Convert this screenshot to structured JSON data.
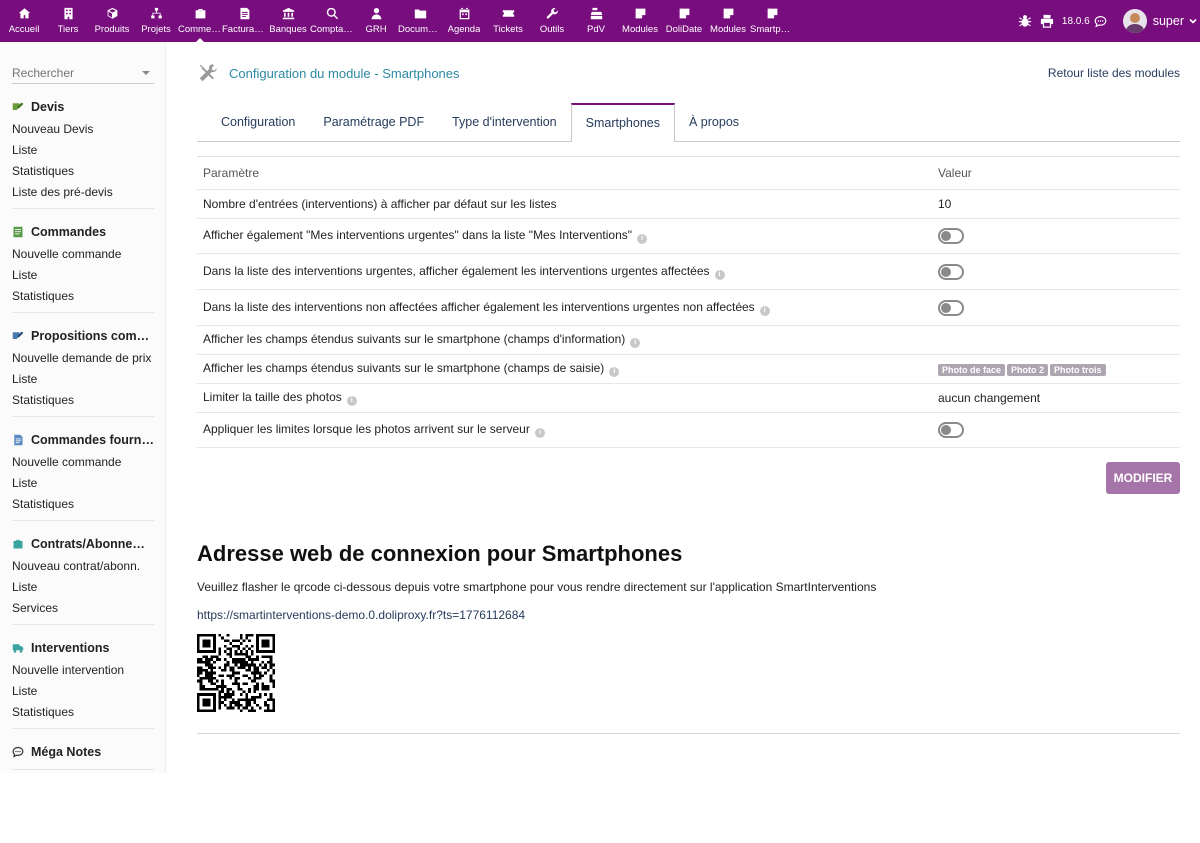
{
  "topnav": [
    {
      "label": "Accueil",
      "icon": "home-icon"
    },
    {
      "label": "Tiers",
      "icon": "building-icon"
    },
    {
      "label": "Produits",
      "icon": "cube-icon"
    },
    {
      "label": "Projets",
      "icon": "sitemap-icon"
    },
    {
      "label": "Commercial",
      "icon": "briefcase-icon",
      "active": true
    },
    {
      "label": "Facturation",
      "icon": "invoice-icon"
    },
    {
      "label": "Banques",
      "icon": "bank-icon"
    },
    {
      "label": "Comptabilité",
      "icon": "magnifier-icon"
    },
    {
      "label": "GRH",
      "icon": "user-tie-icon"
    },
    {
      "label": "Documents",
      "icon": "folder-icon"
    },
    {
      "label": "Agenda",
      "icon": "calendar-icon"
    },
    {
      "label": "Tickets",
      "icon": "ticket-icon"
    },
    {
      "label": "Outils",
      "icon": "wrench-icon"
    },
    {
      "label": "PdV",
      "icon": "cash-register-icon"
    },
    {
      "label": "Modules",
      "icon": "note-icon"
    },
    {
      "label": "DoliDate",
      "icon": "note-icon"
    },
    {
      "label": "Modules",
      "icon": "note-icon"
    },
    {
      "label": "Smartphones",
      "icon": "note-icon"
    }
  ],
  "topright": {
    "version": "18.0.6",
    "username": "super"
  },
  "sidebar": {
    "search_placeholder": "Rechercher",
    "blocks": [
      {
        "title": "Devis",
        "icon": "proposal-icon",
        "color": "#6a9a3a",
        "links": [
          "Nouveau Devis",
          "Liste",
          "Statistiques",
          "Liste des pré-devis"
        ]
      },
      {
        "title": "Commandes",
        "icon": "order-icon",
        "color": "#5a9a4a",
        "links": [
          "Nouvelle commande",
          "Liste",
          "Statistiques"
        ]
      },
      {
        "title": "Propositions commerciales fournisseurs",
        "icon": "supplier-proposal-icon",
        "color": "#4a7ab0",
        "links": [
          "Nouvelle demande de prix",
          "Liste",
          "Statistiques"
        ]
      },
      {
        "title": "Commandes fournisseurs",
        "icon": "supplier-order-icon",
        "color": "#5a8ac0",
        "links": [
          "Nouvelle commande",
          "Liste",
          "Statistiques"
        ]
      },
      {
        "title": "Contrats/Abonnements",
        "icon": "contract-icon",
        "color": "#3aa3a0",
        "links": [
          "Nouveau contrat/abonn.",
          "Liste",
          "Services"
        ]
      },
      {
        "title": "Interventions",
        "icon": "truck-icon",
        "color": "#3aa3a0",
        "links": [
          "Nouvelle intervention",
          "Liste",
          "Statistiques"
        ]
      },
      {
        "title": "Méga Notes",
        "icon": "comment-icon",
        "color": "#333333",
        "links": []
      }
    ]
  },
  "header": {
    "title": "Configuration du module - Smartphones",
    "back_link": "Retour liste des modules"
  },
  "tabs": [
    "Configuration",
    "Paramétrage PDF",
    "Type d'intervention",
    "Smartphones",
    "À propos"
  ],
  "active_tab": 3,
  "table": {
    "headers": [
      "Paramètre",
      "Valeur"
    ],
    "rows": [
      {
        "label": "Nombre d'entrées (interventions) à afficher par défaut sur les listes",
        "info": false,
        "type": "text",
        "value": "10"
      },
      {
        "label": "Afficher également \"Mes interventions urgentes\" dans la liste \"Mes Interventions\"",
        "info": true,
        "type": "toggle",
        "value": "off"
      },
      {
        "label": "Dans la liste des interventions urgentes, afficher également les interventions urgentes affectées",
        "info": true,
        "type": "toggle",
        "value": "off"
      },
      {
        "label": "Dans la liste des interventions non affectées afficher également les interventions urgentes non affectées",
        "info": true,
        "type": "toggle",
        "value": "off"
      },
      {
        "label": "Afficher les champs étendus suivants sur le smartphone (champs d'information)",
        "info": true,
        "type": "text",
        "value": ""
      },
      {
        "label": "Afficher les champs étendus suivants sur le smartphone (champs de saisie)",
        "info": true,
        "type": "tags",
        "value": [
          "Photo de face",
          "Photo 2",
          "Photo trois"
        ]
      },
      {
        "label": "Limiter la taille des photos",
        "info": true,
        "type": "text",
        "value": "aucun changement"
      },
      {
        "label": "Appliquer les limites lorsque les photos arrivent sur le serveur",
        "info": true,
        "type": "toggle",
        "value": "off"
      }
    ]
  },
  "modify_button": "MODIFIER",
  "section": {
    "title": "Adresse web de connexion pour Smartphones",
    "description": "Veuillez flasher le qrcode ci-dessous depuis votre smartphone pour vous rendre directement sur l'application SmartInterventions",
    "url": "https://smartinterventions-demo.0.doliproxy.fr?ts=1776112684"
  },
  "colors": {
    "topbar": "#780d7e",
    "button": "#a574a8",
    "title": "#2b8aa2",
    "link": "#263c5c"
  }
}
